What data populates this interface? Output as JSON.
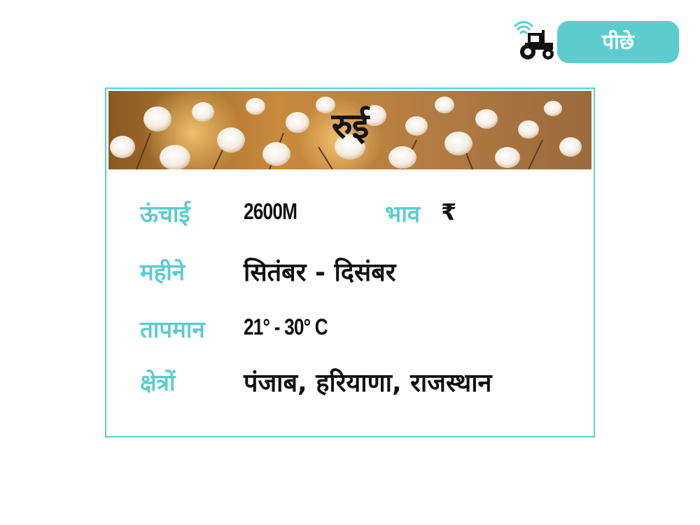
{
  "header": {
    "back_label": "पीछे",
    "logo_icon": "tractor-wifi-icon"
  },
  "card": {
    "title": "रुई",
    "banner_icon": "cotton-field-image",
    "rows": {
      "height": {
        "label": "ऊंचाई",
        "value": "2600M"
      },
      "price": {
        "label": "भाव",
        "value": "₹"
      },
      "months": {
        "label": "महीने",
        "value": "सितंबर - दिसंबर"
      },
      "temperature": {
        "label": "तापमान",
        "value": "21° - 30° C"
      },
      "regions": {
        "label": "क्षेत्रों",
        "value": "पंजाब, हरियाणा, राजस्थान"
      }
    }
  },
  "colors": {
    "accent": "#5ccccf",
    "text": "#111111",
    "background": "#ffffff"
  }
}
